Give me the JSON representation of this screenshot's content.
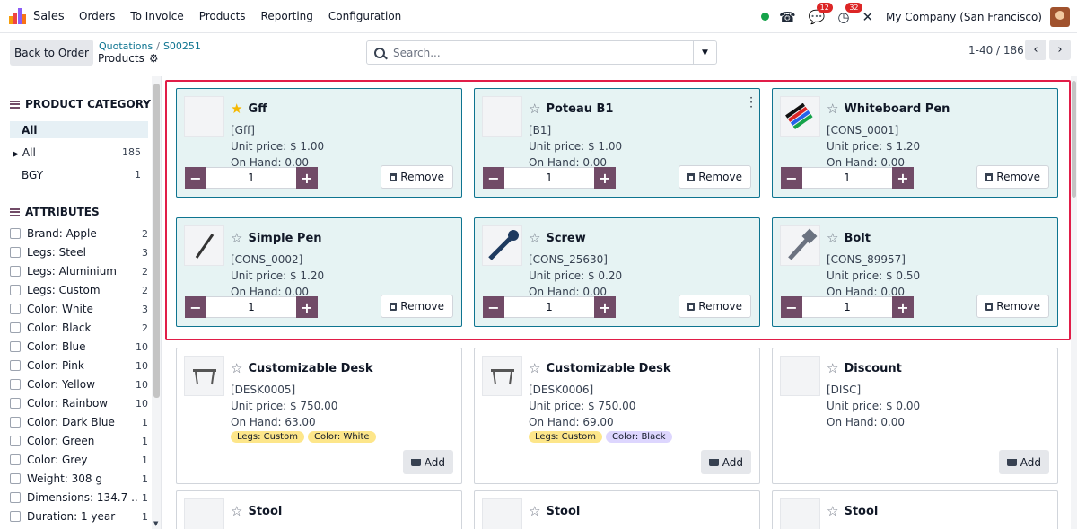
{
  "app": {
    "name": "Sales",
    "nav": [
      "Orders",
      "To Invoice",
      "Products",
      "Reporting",
      "Configuration"
    ],
    "brand_color": "#714b67"
  },
  "systray": {
    "chat_count": "12",
    "activity_count": "32",
    "company": "My Company (San Francisco)"
  },
  "control": {
    "back_label": "Back to Order",
    "breadcrumb": [
      "Quotations",
      "S00251"
    ],
    "page_title": "Products",
    "search_placeholder": "Search...",
    "pager": "1-40 / 186"
  },
  "sidebar": {
    "category_title": "PRODUCT CATEGORY",
    "categories": [
      {
        "label": "All",
        "count": ""
      },
      {
        "label": "All",
        "count": "185"
      },
      {
        "label": "BGY",
        "count": "1"
      }
    ],
    "attributes_title": "ATTRIBUTES",
    "attributes": [
      {
        "label": "Brand: Apple",
        "count": "2"
      },
      {
        "label": "Legs: Steel",
        "count": "3"
      },
      {
        "label": "Legs: Aluminium",
        "count": "2"
      },
      {
        "label": "Legs: Custom",
        "count": "2"
      },
      {
        "label": "Color: White",
        "count": "3"
      },
      {
        "label": "Color: Black",
        "count": "2"
      },
      {
        "label": "Color: Blue",
        "count": "10"
      },
      {
        "label": "Color: Pink",
        "count": "10"
      },
      {
        "label": "Color: Yellow",
        "count": "10"
      },
      {
        "label": "Color: Rainbow",
        "count": "10"
      },
      {
        "label": "Color: Dark Blue",
        "count": "1"
      },
      {
        "label": "Color: Green",
        "count": "1"
      },
      {
        "label": "Color: Grey",
        "count": "1"
      },
      {
        "label": "Weight: 308 g",
        "count": "1"
      },
      {
        "label": "Dimensions: 134.7 ...",
        "count": "1"
      },
      {
        "label": "Duration: 1 year",
        "count": "1"
      }
    ]
  },
  "labels": {
    "remove": "Remove",
    "add": "Add"
  },
  "products": [
    {
      "name": "Gff",
      "ref": "[Gff]",
      "price": "Unit price: $ 1.00",
      "on_hand": "On Hand: 0.00",
      "qty": "1"
    },
    {
      "name": "Poteau B1",
      "ref": "[B1]",
      "price": "Unit price: $ 1.00",
      "on_hand": "On Hand: 0.00",
      "qty": "1"
    },
    {
      "name": "Whiteboard Pen",
      "ref": "[CONS_0001]",
      "price": "Unit price: $ 1.20",
      "on_hand": "On Hand: 0.00",
      "qty": "1"
    },
    {
      "name": "Simple Pen",
      "ref": "[CONS_0002]",
      "price": "Unit price: $ 1.20",
      "on_hand": "On Hand: 0.00",
      "qty": "1"
    },
    {
      "name": "Screw",
      "ref": "[CONS_25630]",
      "price": "Unit price: $ 0.20",
      "on_hand": "On Hand: 0.00",
      "qty": "1"
    },
    {
      "name": "Bolt",
      "ref": "[CONS_89957]",
      "price": "Unit price: $ 0.50",
      "on_hand": "On Hand: 0.00",
      "qty": "1"
    },
    {
      "name": "Customizable Desk",
      "ref": "[DESK0005]",
      "price": "Unit price: $ 750.00",
      "on_hand": "On Hand: 63.00",
      "tags": [
        "Legs: Custom",
        "Color: White"
      ]
    },
    {
      "name": "Customizable Desk",
      "ref": "[DESK0006]",
      "price": "Unit price: $ 750.00",
      "on_hand": "On Hand: 69.00",
      "tags": [
        "Legs: Custom",
        "Color: Black"
      ]
    },
    {
      "name": "Discount",
      "ref": "[DISC]",
      "price": "Unit price: $ 0.00",
      "on_hand": "On Hand: 0.00"
    },
    {
      "name": "Stool"
    },
    {
      "name": "Stool"
    },
    {
      "name": "Stool"
    }
  ]
}
